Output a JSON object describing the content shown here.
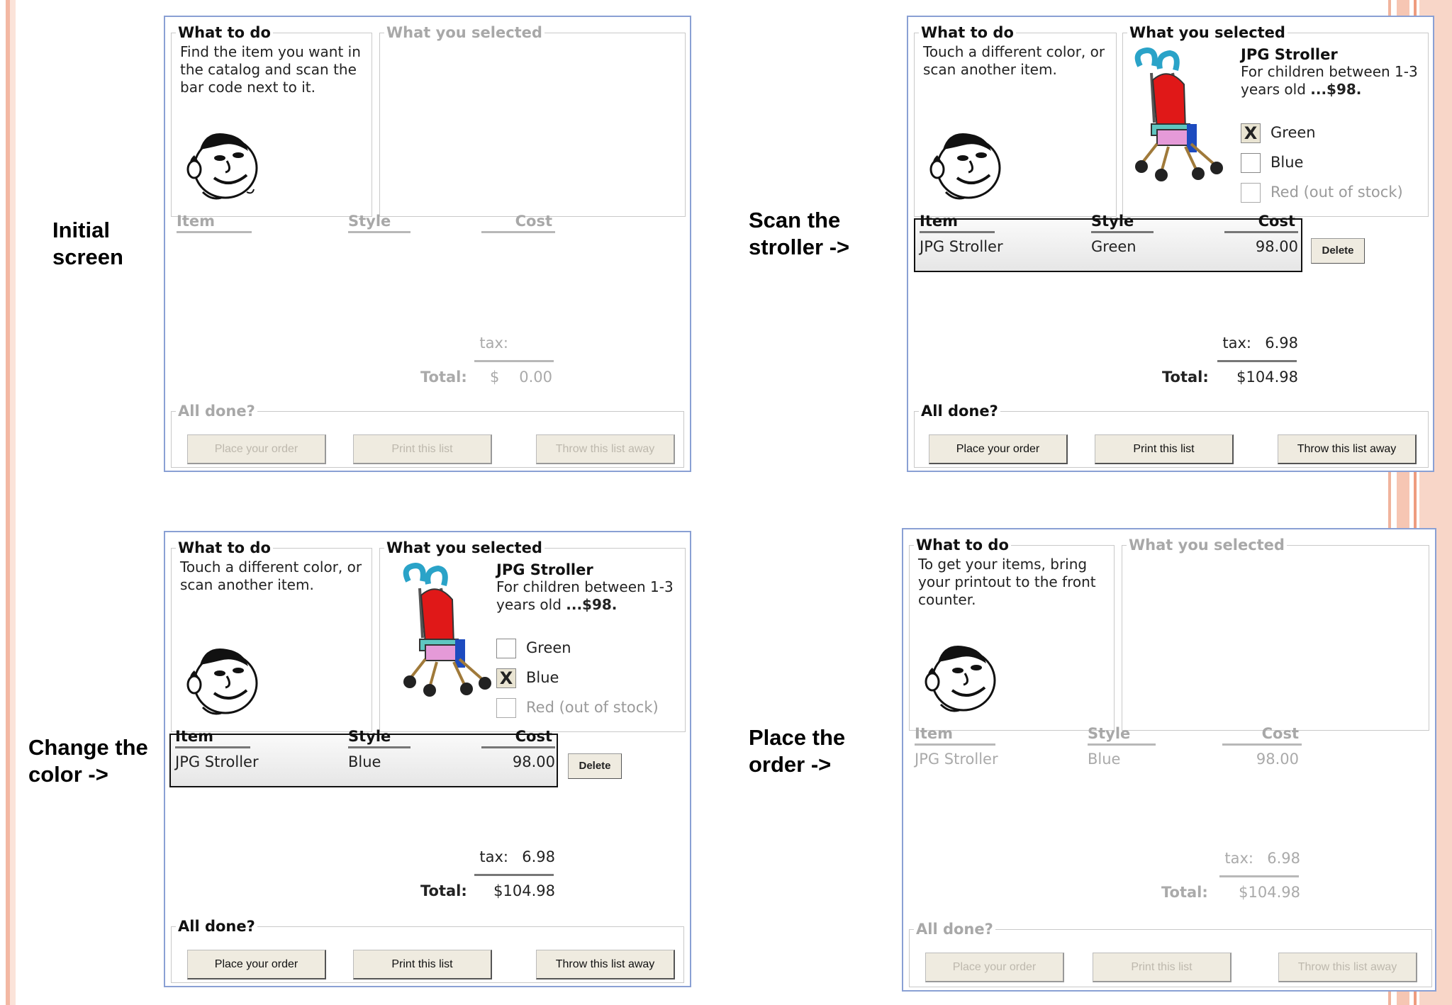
{
  "captions": {
    "p1": "Initial\nscreen",
    "p2": "Scan the\nstroller ->",
    "p3": "Change the\ncolor ->",
    "p4": "Place the\norder ->"
  },
  "labels": {
    "what_to_do": "What to do",
    "what_selected": "What you selected",
    "item": "Item",
    "style": "Style",
    "cost": "Cost",
    "tax": "tax:",
    "total": "Total:",
    "all_done": "All done?",
    "place_order": "Place your order",
    "print_list": "Print this list",
    "throw_away": "Throw this list away",
    "delete": "Delete"
  },
  "product": {
    "title": "JPG Stroller",
    "desc": "For children between 1-3 years old",
    "price": "...$98.",
    "options": [
      "Green",
      "Blue",
      "Red (out of stock)"
    ]
  },
  "panels": {
    "p1": {
      "instruction": "Find the item you want in the catalog and scan the bar code next to it.",
      "tax": "",
      "total_currency": "$",
      "total": "0.00"
    },
    "p2": {
      "instruction": "Touch a different color, or scan another item.",
      "checked": "X",
      "row_item": "JPG Stroller",
      "row_style": "Green",
      "row_cost": "98.00",
      "tax": "6.98",
      "total": "$104.98"
    },
    "p3": {
      "instruction": "Touch a different color, or scan another item.",
      "checked": "X",
      "row_item": "JPG Stroller",
      "row_style": "Blue",
      "row_cost": "98.00",
      "tax": "6.98",
      "total": "$104.98"
    },
    "p4": {
      "instruction": "To get your items, bring your printout to the front counter.",
      "row_item": "JPG Stroller",
      "row_style": "Blue",
      "row_cost": "98.00",
      "tax": "6.98",
      "total": "$104.98"
    }
  },
  "colors": {
    "panel_border": "#8aa0d4",
    "button_face": "#efebe0",
    "slide_accent": "#f3b8a3"
  },
  "icons": [
    "cartoon-face-icon",
    "stroller-image"
  ]
}
